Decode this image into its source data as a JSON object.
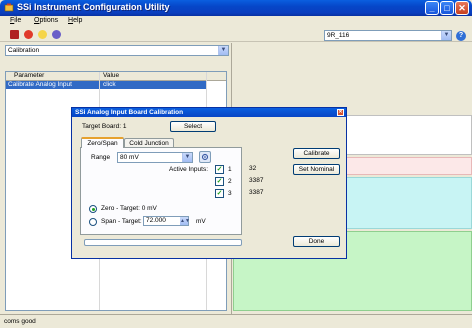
{
  "window": {
    "title": "SSi Instrument Configuration Utility"
  },
  "menu": [
    {
      "label": "File",
      "accel": "F",
      "rest": "ile"
    },
    {
      "label": "Options",
      "accel": "O",
      "rest": "ptions"
    },
    {
      "label": "Help",
      "accel": "H",
      "rest": "elp"
    }
  ],
  "toolbar": {
    "icons": [
      "plug-icon",
      "red-stop-icon",
      "lightbulb-icon",
      "settings-gear-icon"
    ],
    "instrument_combo": "9R_116"
  },
  "left": {
    "category_combo": "Calibration",
    "grid": {
      "headers": {
        "parameter": "Parameter",
        "value": "Value"
      },
      "rows": [
        {
          "parameter": "Calibrate Analog Input",
          "value": "click"
        }
      ]
    }
  },
  "colors": {
    "right_band_pink": "#fce8e8",
    "right_band_cyan": "#c8f4f4",
    "right_band_green": "#c6f5c6",
    "selected_row": "#316ac5"
  },
  "status": {
    "text": "coms good"
  },
  "dialog": {
    "title": "SSi Analog Input Board Calibration",
    "target_board_label": "Target Board: 1",
    "select_button": "Select",
    "tabs": [
      "Zero/Span",
      "Cold Junction"
    ],
    "range_label": "Range",
    "range_value": "80 mV",
    "active_inputs_label": "Active Inputs:",
    "inputs": [
      {
        "num": "1",
        "value": "32",
        "checked": true
      },
      {
        "num": "2",
        "value": "3387",
        "checked": true
      },
      {
        "num": "3",
        "value": "3387",
        "checked": true
      }
    ],
    "zero_label": "Zero - Target: 0 mV",
    "span_label": "Span - Target:",
    "span_value": "72.000",
    "span_unit": "mV",
    "calibrate_button": "Calibrate",
    "set_nominal_button": "Set Nominal",
    "done_button": "Done",
    "progress": 0
  }
}
